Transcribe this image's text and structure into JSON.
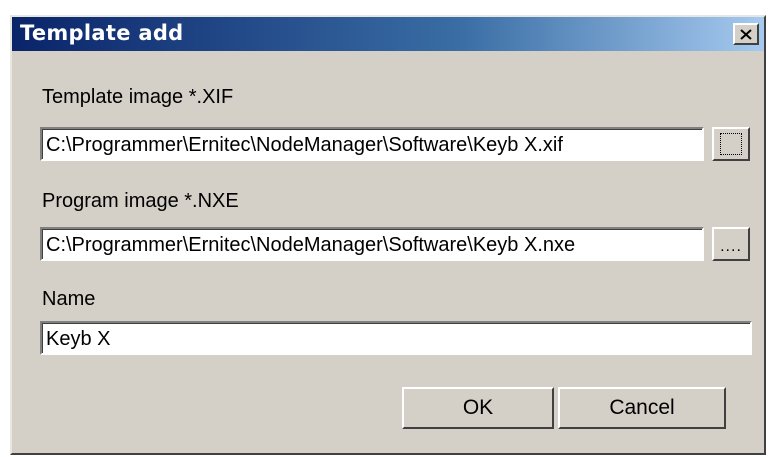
{
  "dialog": {
    "title": "Template add",
    "close_icon": "close-icon"
  },
  "template_image": {
    "label": "Template image *.XIF",
    "value": "C:\\Programmer\\Ernitec\\NodeManager\\Software\\Keyb X.xif",
    "browse_label": ""
  },
  "program_image": {
    "label": "Program image *.NXE",
    "value": "C:\\Programmer\\Ernitec\\NodeManager\\Software\\Keyb X.nxe",
    "browse_label": "...."
  },
  "name": {
    "label": "Name",
    "value": "Keyb X"
  },
  "buttons": {
    "ok_label": "OK",
    "cancel_label": "Cancel"
  },
  "colors": {
    "titlebar_start": "#0a246a",
    "titlebar_end": "#a6caf0",
    "face": "#d4d0c8"
  }
}
